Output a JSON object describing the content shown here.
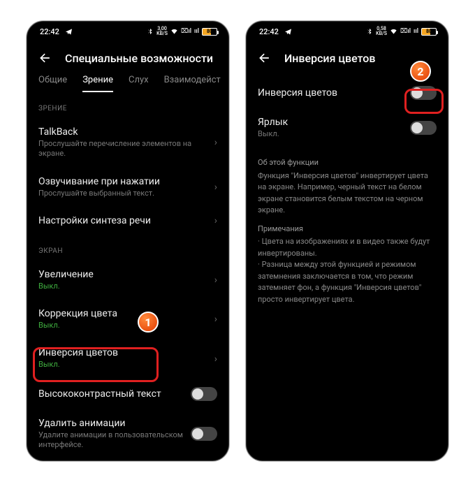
{
  "status": {
    "time": "22:42",
    "kbs_top": "3,00",
    "kbs_top2": "0,58",
    "kbs_bot": "KB/S",
    "battery": "80"
  },
  "left": {
    "title": "Специальные возможности",
    "tabs": [
      "Общие",
      "Зрение",
      "Слух",
      "Взаимодейст"
    ],
    "section_vision": "ЗРЕНИЕ",
    "talkback": {
      "title": "TalkBack",
      "sub": "Прослушайте перечисление элементов на экране."
    },
    "speak": {
      "title": "Озвучивание при нажатии",
      "sub": "Прослушайте выбранный текст."
    },
    "tts": {
      "title": "Настройки синтеза речи"
    },
    "section_screen": "ЭКРАН",
    "magnif": {
      "title": "Увеличение",
      "sub": "Выкл."
    },
    "color": {
      "title": "Коррекция цвета",
      "sub": "Выкл."
    },
    "inversion": {
      "title": "Инверсия цветов",
      "sub": "Выкл."
    },
    "highcontrast": {
      "title": "Высококонтрастный текст"
    },
    "removeanim": {
      "title": "Удалить анимации",
      "sub": "Удалите анимации в пользовательском интерфейсе."
    }
  },
  "right": {
    "title": "Инверсия цветов",
    "row_inversion": "Инверсия цветов",
    "row_shortcut": {
      "title": "Ярлык",
      "sub": "Выкл."
    },
    "about_head": "Об этой функции",
    "about_body": "Функция \"Инверсия цветов\" инвертирует цвета на экране. Например, черный текст на белом экране становится белым текстом на черном экране.",
    "notes_head": "Примечания",
    "note1": "· Цвета на изображениях и в видео также будут инвертированы.",
    "note2": "· Разница между этой функцией и режимом затемнения заключается в том, что режим затемняет фон, а функция \"Инверсия цветов\" просто инвертирует цвета."
  },
  "badges": {
    "one": "1",
    "two": "2"
  }
}
